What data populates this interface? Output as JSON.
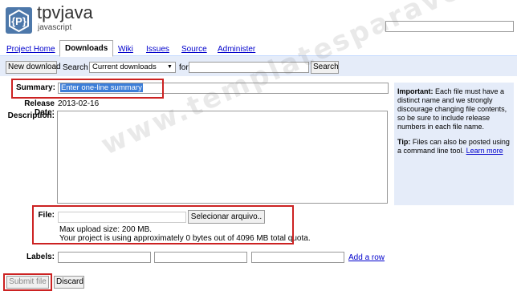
{
  "header": {
    "project_name": "tpvjava",
    "project_summary": "javascript",
    "logo_icon": "project-logo-icon"
  },
  "tabs": [
    {
      "label": "Project Home",
      "active": false
    },
    {
      "label": "Downloads",
      "active": true
    },
    {
      "label": "Wiki",
      "active": false
    },
    {
      "label": "Issues",
      "active": false
    },
    {
      "label": "Source",
      "active": false
    },
    {
      "label": "Administer",
      "active": false
    }
  ],
  "subbar": {
    "new_download_label": "New download",
    "search_label": "Search",
    "search_scope": "Current downloads",
    "for_label": "for",
    "search_button_label": "Search"
  },
  "form": {
    "summary_label": "Summary:",
    "summary_value": "Enter one-line summary",
    "release_date_label": "Release Date:",
    "release_date_value": "2013-02-16",
    "description_label": "Description:",
    "file_label": "File:",
    "choose_file_label": "Selecionar arquivo..",
    "max_upload": "Max upload size: 200 MB.",
    "quota": "Your project is using approximately 0 bytes out of 4096 MB total quota.",
    "labels_label": "Labels:",
    "add_row_label": "Add a row",
    "submit_label": "Submit file",
    "discard_label": "Discard"
  },
  "sidebar": {
    "important_label": "Important:",
    "important_text": "Each file must have a distinct name and we strongly discourage changing file contents, so be sure to include release numbers in each file name.",
    "tip_label": "Tip:",
    "tip_text": "Files can also be posted using a command line tool.",
    "learn_more": "Learn more"
  },
  "watermark": "www.templatesparavoce.com",
  "colors": {
    "accent": "#e5ecf9",
    "link": "#0000cc",
    "annotation": "#cc2222",
    "selection": "#3d7ed8"
  }
}
